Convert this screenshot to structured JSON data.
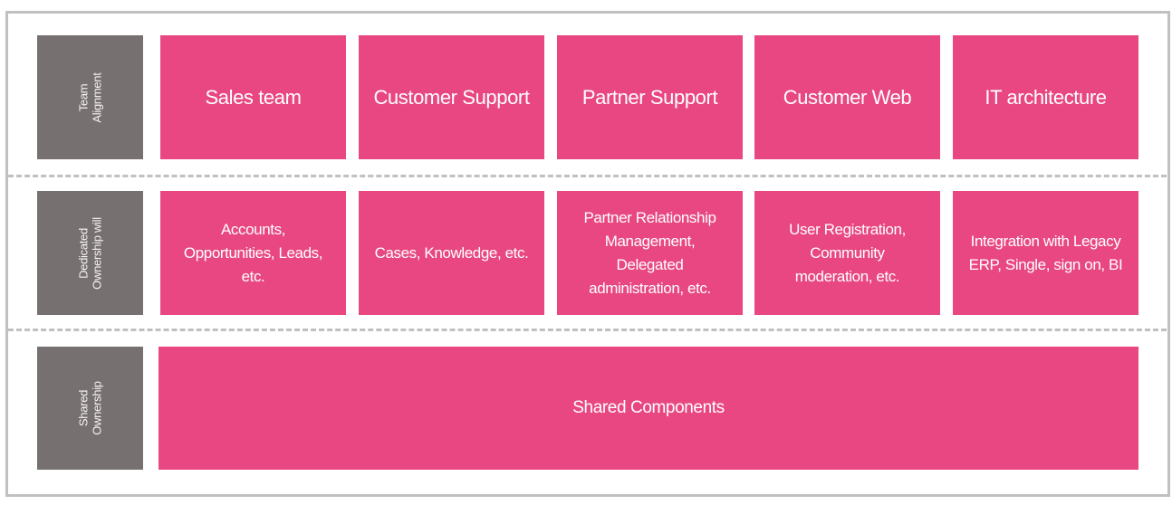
{
  "colors": {
    "accent": "#e84781",
    "label_bg": "#767170",
    "border": "#c0c0c0"
  },
  "rows": [
    {
      "label": "Team\nAlignment",
      "cells": [
        "Sales team",
        "Customer Support",
        "Partner Support",
        "Customer Web",
        "IT architecture"
      ]
    },
    {
      "label": "Dedicated\nOwnership will",
      "cells": [
        "Accounts,\nOpportunities, Leads,\netc.",
        "Cases, Knowledge, etc.",
        "Partner Relationship\nManagement,\nDelegated\nadministration, etc.",
        "User Registration,\nCommunity\nmoderation, etc.",
        "Integration with Legacy\nERP, Single, sign on, BI"
      ]
    },
    {
      "label": "Shared\nOwnership",
      "cells": [
        "Shared Components"
      ]
    }
  ]
}
